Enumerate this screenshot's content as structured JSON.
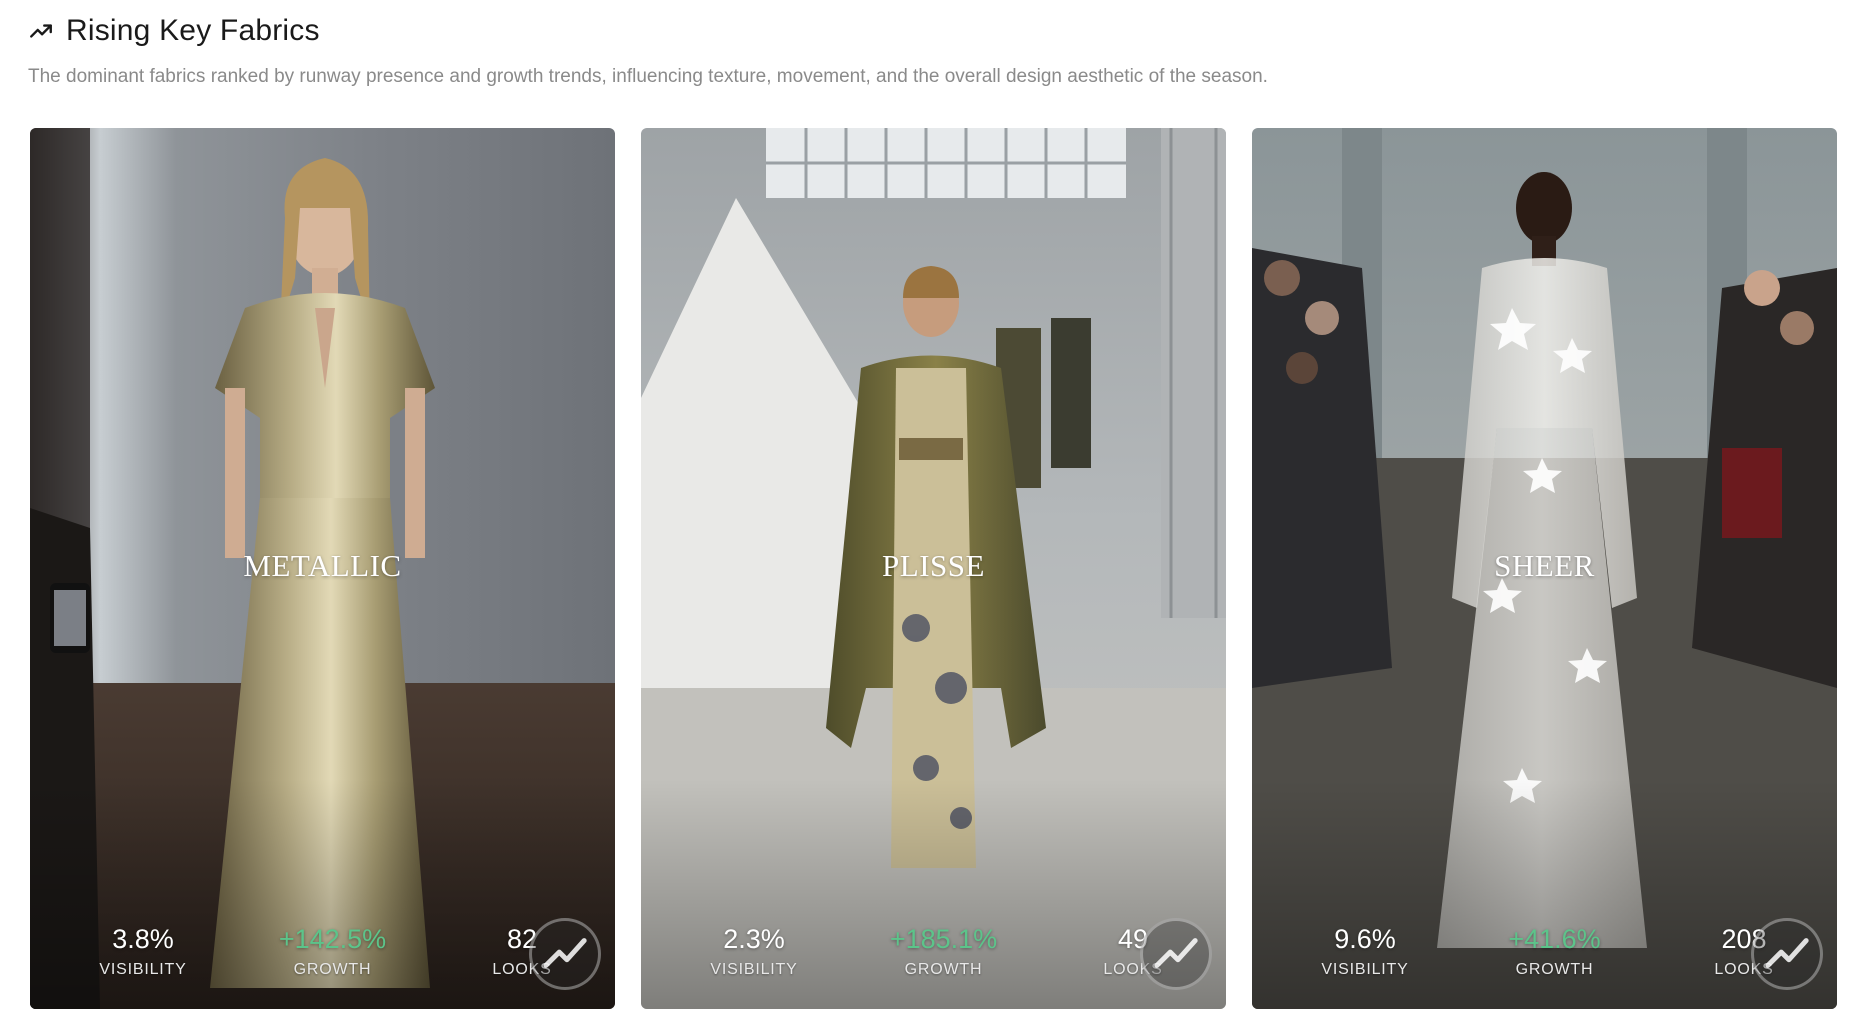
{
  "header": {
    "title": "Rising Key Fabrics",
    "icon": "trending-up-icon",
    "subtitle": "The dominant fabrics ranked by runway presence and growth trends, influencing texture, movement, and the overall design aesthetic of the season."
  },
  "cards": [
    {
      "name": "METALLIC",
      "visibility": "3.8%",
      "visibility_label": "VISIBILITY",
      "growth": "+142.5%",
      "growth_label": "GROWTH",
      "looks": "82",
      "looks_label": "LOOKS",
      "icon": "trend-chart-icon"
    },
    {
      "name": "PLISSE",
      "visibility": "2.3%",
      "visibility_label": "VISIBILITY",
      "growth": "+185.1%",
      "growth_label": "GROWTH",
      "looks": "49",
      "looks_label": "LOOKS",
      "icon": "trend-chart-icon"
    },
    {
      "name": "SHEER",
      "visibility": "9.6%",
      "visibility_label": "VISIBILITY",
      "growth": "+41.6%",
      "growth_label": "GROWTH",
      "looks": "208",
      "looks_label": "LOOKS",
      "icon": "trend-chart-icon"
    }
  ],
  "colors": {
    "growth": "#5cc48a",
    "subtitle": "#8a8a8a"
  }
}
